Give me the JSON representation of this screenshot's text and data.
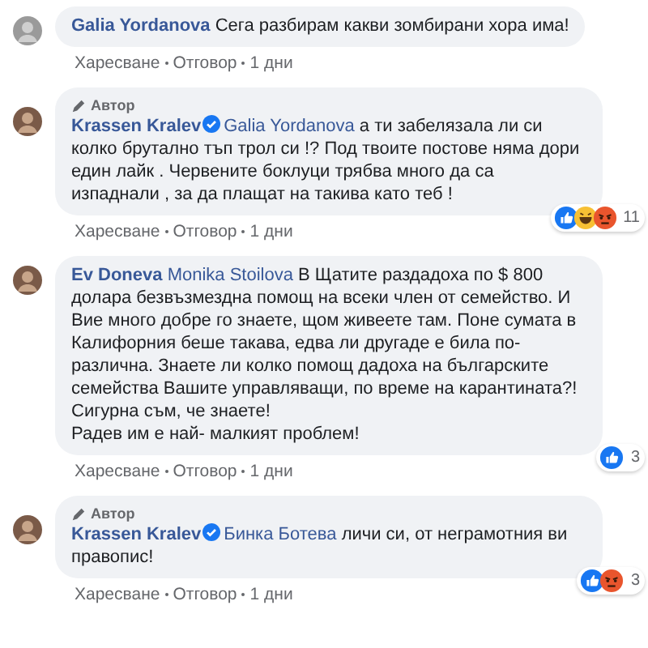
{
  "comments": [
    {
      "author": "Galia Yordanova",
      "text": "Сега разбирам какви зомбирани хора има!",
      "actions": [
        "Харесване",
        "Отговор",
        "1 дни"
      ]
    },
    {
      "author_badge": "Автор",
      "author": "Krassen Kralev",
      "verified": true,
      "mention": "Galia Yordanova",
      "text": "а ти забелязала ли си колко брутално тъп трол си !? Под твоите постове няма дори един лайк . Червените боклуци трябва много да са изпаднали , за да плащат на такива като теб !",
      "actions": [
        "Харесване",
        "Отговор",
        "1 дни"
      ],
      "reactions": {
        "icons": [
          {
            "kind": "like"
          },
          {
            "kind": "haha"
          },
          {
            "kind": "angry"
          }
        ],
        "count": "11"
      }
    },
    {
      "author": "Ev Doneva",
      "mention": "Monika Stoilova",
      "text": "В Щатите раздадоха по $ 800 долара безвъзмездна помощ на всеки член от семейство. И Вие много добре го знаете, щом живеете там. Поне сумата в Калифорния беше такава, едва ли другаде е била по-различна. Знаете ли колко помощ дадоха на българските семейства Вашите управляващи, по време на карантината?!\nСигурна съм, че знаете!\nРадев им е най- малкият проблем!",
      "actions": [
        "Харесване",
        "Отговор",
        "1 дни"
      ],
      "reactions": {
        "icons": [
          {
            "kind": "like"
          }
        ],
        "count": "3"
      }
    },
    {
      "author_badge": "Автор",
      "author": "Krassen Kralev",
      "verified": true,
      "mention": "Бинка Ботева",
      "text": "личи си, от неграмотния ви правопис!",
      "actions": [
        "Харесване",
        "Отговор",
        "1 дни"
      ],
      "reactions": {
        "icons": [
          {
            "kind": "like"
          },
          {
            "kind": "angry"
          }
        ],
        "count": "3"
      }
    }
  ]
}
